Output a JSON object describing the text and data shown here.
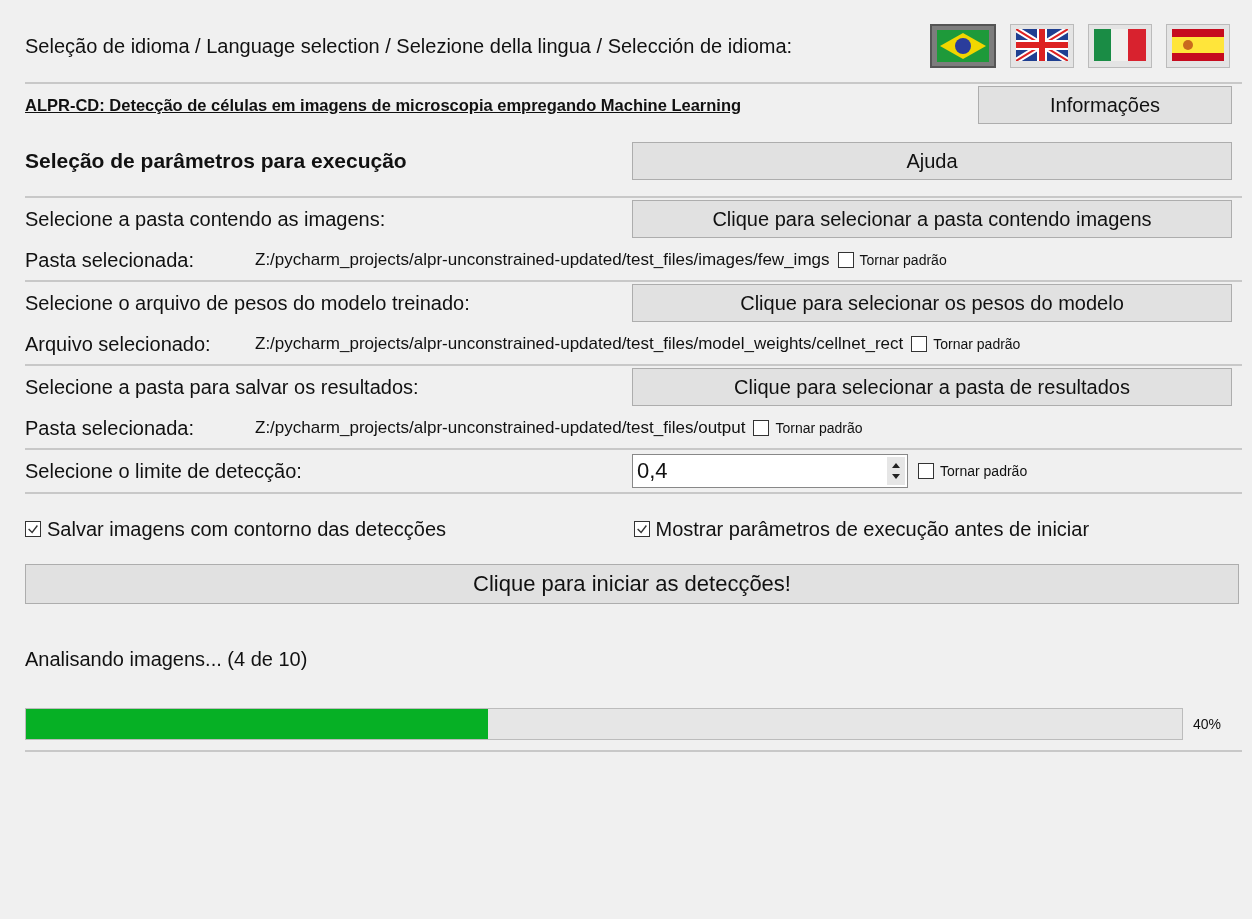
{
  "language": {
    "label": "Seleção de idioma / Language selection / Selezione della lingua / Selección de idioma:",
    "flags": [
      {
        "kind": "br",
        "selected": true
      },
      {
        "kind": "gb",
        "selected": false
      },
      {
        "kind": "it",
        "selected": false
      },
      {
        "kind": "es",
        "selected": false
      }
    ]
  },
  "header": {
    "title": "ALPR-CD: Detecção de células em imagens de microscopia empregando Machine Learning",
    "button": "Informações"
  },
  "params": {
    "title": "Seleção de parâmetros para execução",
    "button": "Ajuda"
  },
  "selections": [
    {
      "label": "Selecione a pasta contendo as imagens:",
      "button": "Clique para selecionar a pasta contendo imagens",
      "path_label": "Pasta selecionada:",
      "path": "Z:/pycharm_projects/alpr-unconstrained-updated/test_files/images/few_imgs",
      "default_label": "Tornar padrão",
      "default_checked": false
    },
    {
      "label": "Selecione o arquivo de pesos do modelo treinado:",
      "button": "Clique para selecionar os pesos do modelo",
      "path_label": "Arquivo selecionado:",
      "path": "Z:/pycharm_projects/alpr-unconstrained-updated/test_files/model_weights/cellnet_rect",
      "default_label": "Tornar padrão",
      "default_checked": false
    },
    {
      "label": "Selecione a pasta para salvar os resultados:",
      "button": "Clique para selecionar a pasta de resultados",
      "path_label": "Pasta selecionada:",
      "path": "Z:/pycharm_projects/alpr-unconstrained-updated/test_files/output",
      "default_label": "Tornar padrão",
      "default_checked": false
    }
  ],
  "threshold": {
    "label": "Selecione o limite de detecção:",
    "value": "0,4",
    "default_label": "Tornar padrão",
    "default_checked": false
  },
  "options": [
    {
      "label": "Salvar imagens com contorno das detecções",
      "checked": true
    },
    {
      "label": "Mostrar parâmetros de execução antes de iniciar",
      "checked": true
    }
  ],
  "start_button": "Clique para iniciar as detecções!",
  "progress": {
    "status": "Analisando imagens... (4 de 10)",
    "level": 0.4,
    "reading": "40%"
  }
}
